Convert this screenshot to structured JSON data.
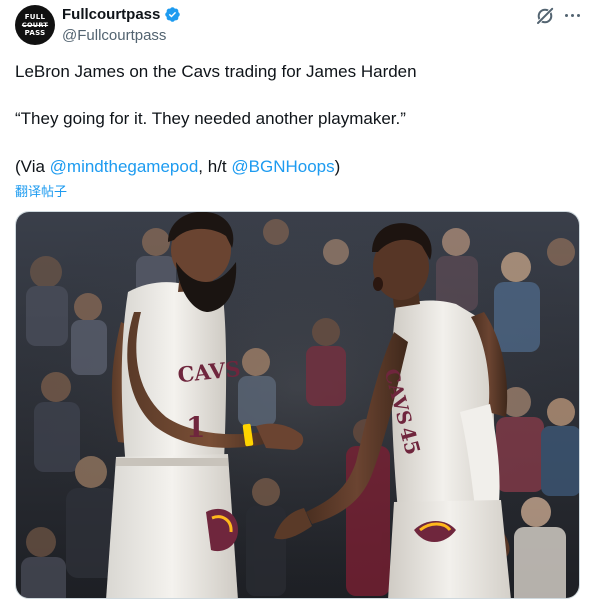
{
  "author": {
    "display_name": "Fullcourtpass",
    "handle": "@Fullcourtpass",
    "avatar_text": [
      "FULL",
      "COURT",
      "PASS"
    ]
  },
  "tweet": {
    "line1": "LeBron James on the Cavs trading for James Harden",
    "line2": "“They going for it. They needed another playmaker.”",
    "line3_prefix": "(Via ",
    "mention1": "@mindthegamepod",
    "line3_mid": ", h/t ",
    "mention2": "@BGNHoops",
    "line3_suffix": ")",
    "translate_label": "翻译帖子"
  },
  "media": {
    "jersey_text_left": "CAVS",
    "jersey_number_left": "1",
    "jersey_text_right": "CAVS",
    "jersey_number_right": "45"
  },
  "colors": {
    "link": "#1d9bf0",
    "verified": "#1d9bf0",
    "secondary_text": "#536471",
    "jersey_wine": "#6f263d",
    "jersey_gold": "#ffb81c"
  },
  "icons": [
    "verified-badge-icon",
    "grok-icon",
    "more-icon"
  ]
}
